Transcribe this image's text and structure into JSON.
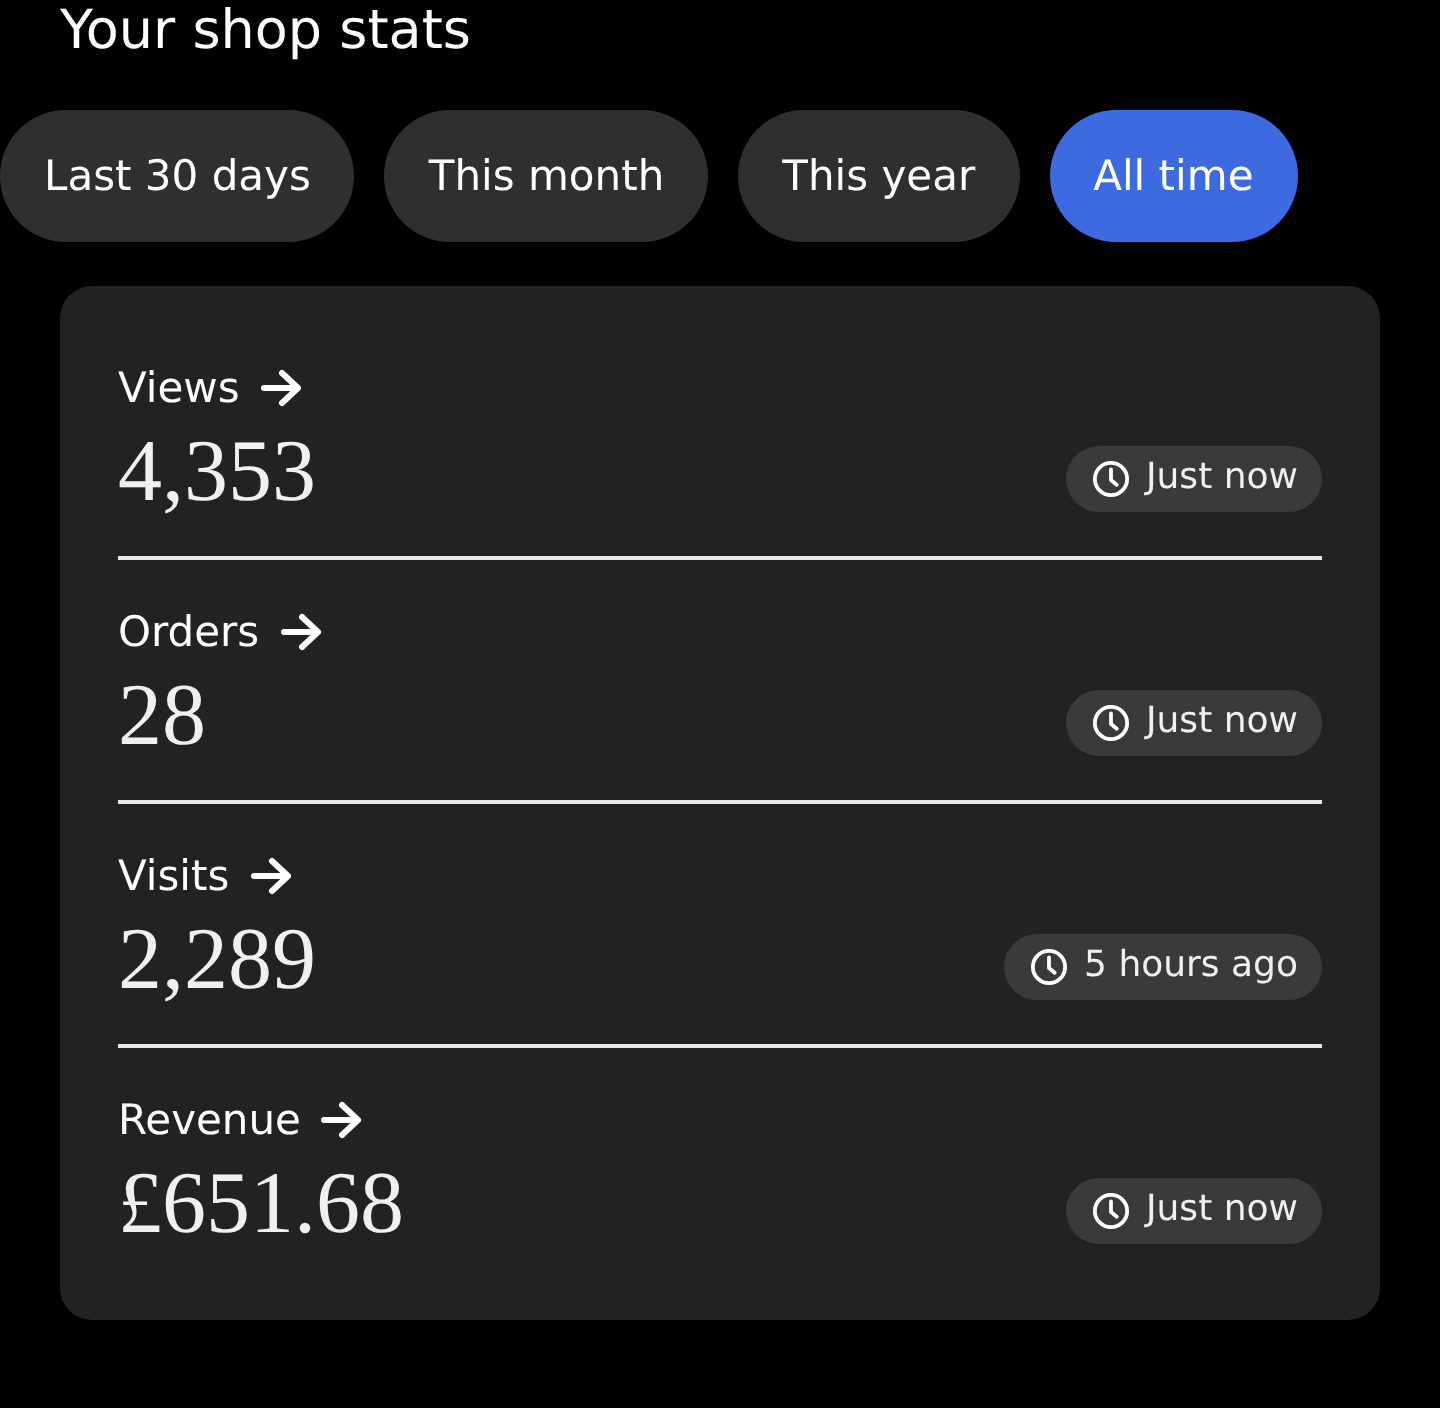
{
  "title": "Your shop stats",
  "tabs": [
    {
      "label": "Last 30 days",
      "selected": false
    },
    {
      "label": "This month",
      "selected": false
    },
    {
      "label": "This year",
      "selected": false
    },
    {
      "label": "All time",
      "selected": true
    }
  ],
  "stats": [
    {
      "label": "Views",
      "value": "4,353",
      "updated": "Just now"
    },
    {
      "label": "Orders",
      "value": "28",
      "updated": "Just now"
    },
    {
      "label": "Visits",
      "value": "2,289",
      "updated": "5 hours ago"
    },
    {
      "label": "Revenue",
      "value": "£651.68",
      "updated": "Just now"
    }
  ]
}
